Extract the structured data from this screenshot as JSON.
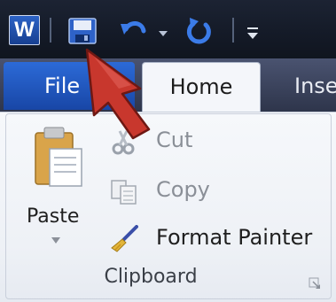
{
  "tabs": {
    "file": "File",
    "home": "Home",
    "insert": "Insert"
  },
  "clipboard": {
    "paste_label": "Paste",
    "cut_label": "Cut",
    "copy_label": "Copy",
    "format_painter_label": "Format Painter",
    "group_label": "Clipboard"
  },
  "icons": {
    "app": "word-logo-icon",
    "save": "save-icon",
    "undo": "undo-icon",
    "redo": "redo-icon",
    "customize": "customize-toolbar-icon",
    "paste": "paste-clipboard-icon",
    "cut": "scissors-icon",
    "copy": "copy-icon",
    "format_painter": "brush-icon",
    "launcher": "dialog-launcher-icon",
    "annotation": "red-arrow-pointer"
  },
  "colors": {
    "file_tab": "#2c6ad7",
    "title_bar": "#1c2333",
    "annotation_arrow": "#c8372d"
  },
  "app_logo_text": "W"
}
